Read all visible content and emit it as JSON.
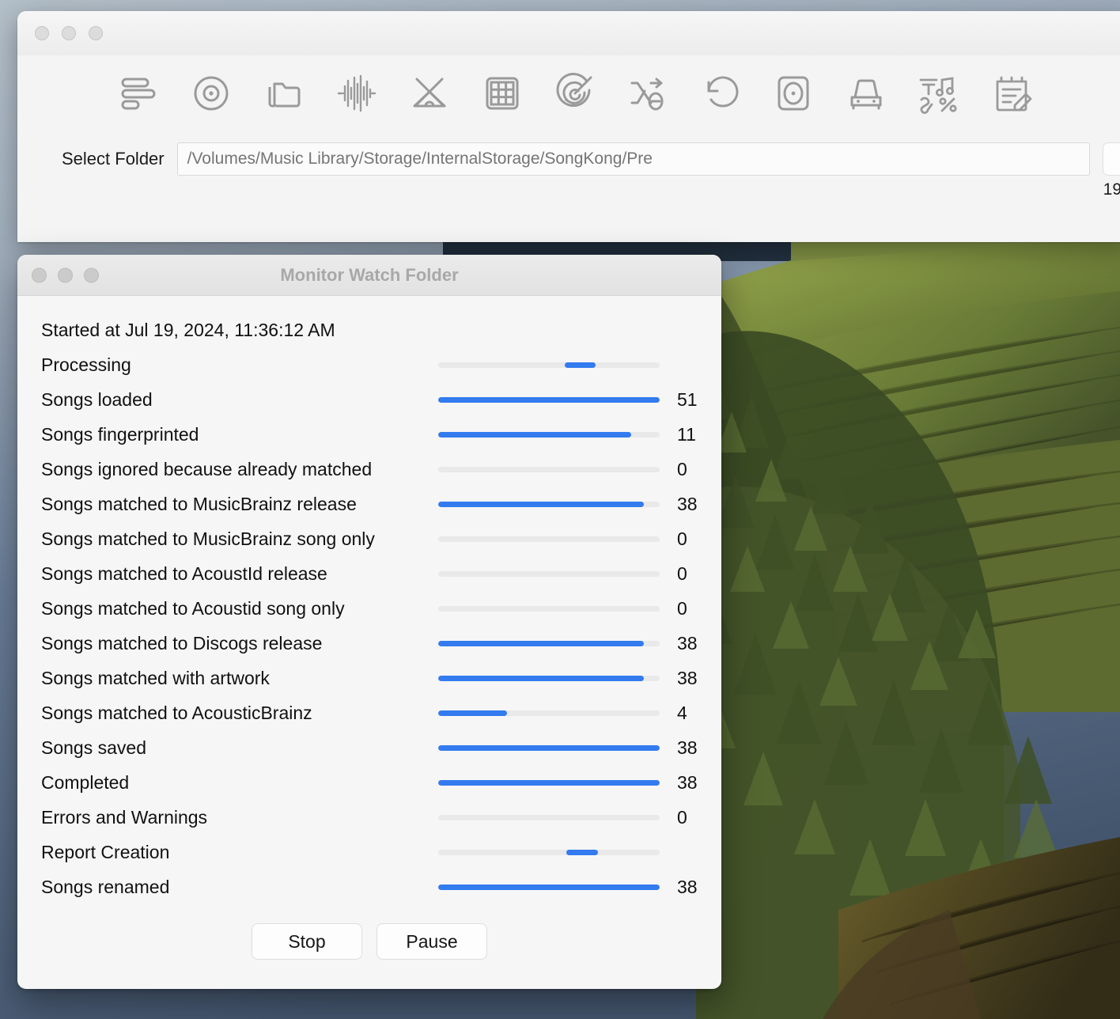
{
  "desktop": {
    "wallpaper_name": "rolling-hills-vineyard-wallpaper",
    "sky_color": "#7f93ab",
    "forest_color": "#3d4a2a",
    "field_color": "#8d9a4a"
  },
  "app_window": {
    "traffic_lights": [
      "close-button",
      "minimize-button",
      "maximize-button"
    ],
    "toolbar": {
      "icons": [
        {
          "name": "sort-lines-icon",
          "label": "Fix Songs"
        },
        {
          "name": "disc-target-icon",
          "label": "Match to Release"
        },
        {
          "name": "folder-copy-icon",
          "label": "Group Files"
        },
        {
          "name": "waveform-icon",
          "label": "Fingerprint"
        },
        {
          "name": "tent-icon",
          "label": "Camp"
        },
        {
          "name": "grid-icon",
          "label": "Grid View"
        },
        {
          "name": "radar-icon",
          "label": "Scan"
        },
        {
          "name": "shuffle-minus-icon",
          "label": "Remove Duplicates"
        },
        {
          "name": "undo-icon",
          "label": "Undo Changes"
        },
        {
          "name": "speaker-icon",
          "label": "Loudness"
        },
        {
          "name": "car-icon",
          "label": "Prepare for Car"
        },
        {
          "name": "format-tags-icon",
          "label": "Tidy Tags"
        },
        {
          "name": "edit-report-icon",
          "label": "Edit Report"
        }
      ]
    },
    "select_folder_label": "Select Folder",
    "folder_path_placeholder": "/Volumes/Music Library/Storage/InternalStorage/SongKong/Pre",
    "browse_button_label": "",
    "partial_count_text": "19"
  },
  "dialog": {
    "title": "Monitor Watch Folder",
    "traffic_lights": [
      "close-button",
      "minimize-button",
      "maximize-button"
    ],
    "started_at": "Started at Jul 19, 2024, 11:36:12 AM",
    "accent_color": "#337bef",
    "track_color": "#e9e9e9",
    "rows": [
      {
        "label": "Processing",
        "value": "",
        "percent": 0,
        "indeterminate": true,
        "chunk_start": 57,
        "chunk_width": 14
      },
      {
        "label": "Songs loaded",
        "value": "51",
        "percent": 100,
        "indeterminate": false
      },
      {
        "label": "Songs fingerprinted",
        "value": "11",
        "percent": 87,
        "indeterminate": false
      },
      {
        "label": "Songs ignored because already matched",
        "value": "0",
        "percent": 0,
        "indeterminate": false
      },
      {
        "label": "Songs matched to MusicBrainz release",
        "value": "38",
        "percent": 93,
        "indeterminate": false
      },
      {
        "label": "Songs matched to MusicBrainz song only",
        "value": "0",
        "percent": 0,
        "indeterminate": false
      },
      {
        "label": "Songs matched to AcoustId release",
        "value": "0",
        "percent": 0,
        "indeterminate": false
      },
      {
        "label": "Songs matched to Acoustid song only",
        "value": "0",
        "percent": 0,
        "indeterminate": false
      },
      {
        "label": "Songs matched to Discogs release",
        "value": "38",
        "percent": 93,
        "indeterminate": false
      },
      {
        "label": "Songs matched with artwork",
        "value": "38",
        "percent": 93,
        "indeterminate": false
      },
      {
        "label": "Songs matched to AcousticBrainz",
        "value": "4",
        "percent": 31,
        "indeterminate": false
      },
      {
        "label": "Songs saved",
        "value": "38",
        "percent": 100,
        "indeterminate": false
      },
      {
        "label": "Completed",
        "value": "38",
        "percent": 100,
        "indeterminate": false
      },
      {
        "label": "Errors and Warnings",
        "value": "0",
        "percent": 0,
        "indeterminate": false
      },
      {
        "label": "Report Creation",
        "value": "",
        "percent": 0,
        "indeterminate": true,
        "chunk_start": 58,
        "chunk_width": 14
      },
      {
        "label": "Songs renamed",
        "value": "38",
        "percent": 100,
        "indeterminate": false
      }
    ],
    "buttons": [
      {
        "name": "stop-button",
        "label": "Stop"
      },
      {
        "name": "pause-button",
        "label": "Pause"
      }
    ]
  }
}
